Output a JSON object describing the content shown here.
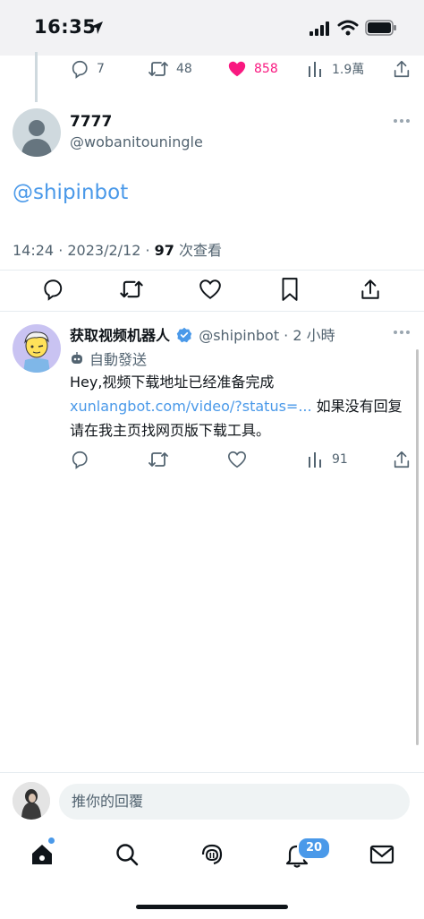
{
  "status_bar": {
    "time": "16:35"
  },
  "previous_tweet": {
    "replies": "7",
    "retweets": "48",
    "likes": "858",
    "views": "1.9萬"
  },
  "main_tweet": {
    "display_name": "7777",
    "handle": "@wobanitouningle",
    "text": "@shipinbot",
    "time": "14:24 · 2023/2/12 · ",
    "view_count": "97",
    "view_label": " 次查看"
  },
  "reply_tweet": {
    "display_name": "获取视频机器人",
    "handle": "@shipinbot",
    "time_ago": " · 2 小時",
    "automated_label": "自動發送",
    "text_line1": "Hey,视频下载地址已经准备完成",
    "link": "xunlangbot.com/video/?status=...",
    "text_after_link": " 如果没有回复请在我主页找网页版下载工具。",
    "views": "91"
  },
  "reply_bar": {
    "placeholder": "推你的回覆"
  },
  "tab_bar": {
    "notifications_badge": "20"
  },
  "colors": {
    "accent": "#4a99e9",
    "like": "#f91880",
    "text_secondary": "#536471"
  }
}
